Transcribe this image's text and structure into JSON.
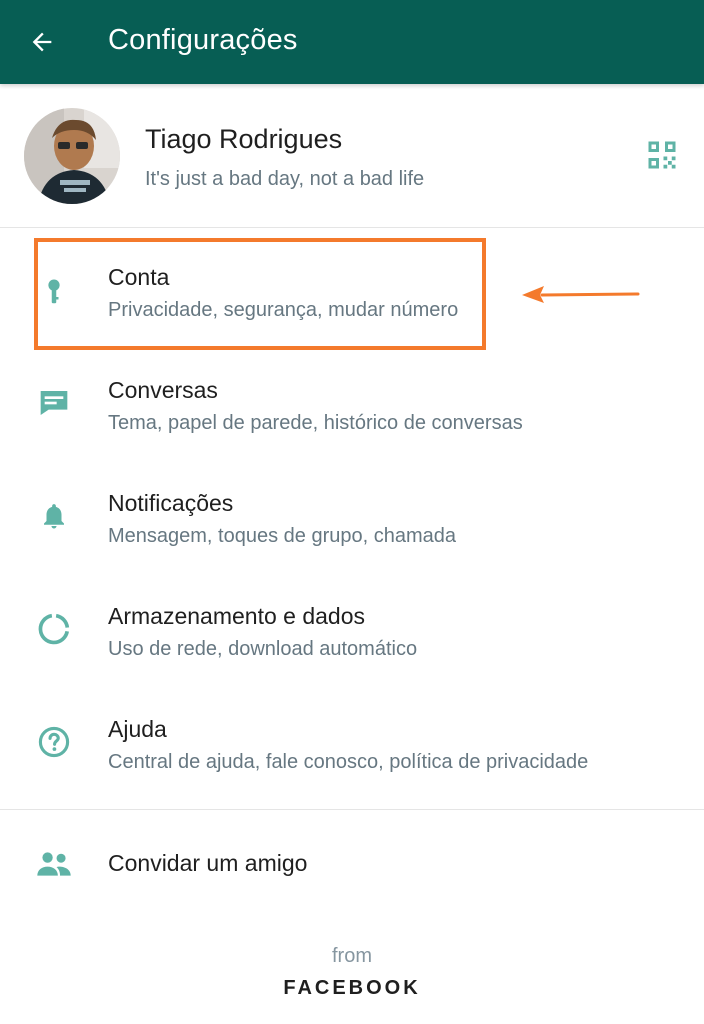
{
  "appbar": {
    "title": "Configurações",
    "background": "#075e54"
  },
  "profile": {
    "name": "Tiago Rodrigues",
    "status": "It's just a bad day, not a bad life",
    "qr_icon": "qr-code-icon"
  },
  "menu": [
    {
      "label": "Conta",
      "sub": "Privacidade, segurança, mudar número",
      "icon": "key-icon"
    },
    {
      "label": "Conversas",
      "sub": "Tema, papel de parede, histórico de conversas",
      "icon": "chat-icon"
    },
    {
      "label": "Notificações",
      "sub": "Mensagem, toques de grupo, chamada",
      "icon": "bell-icon"
    },
    {
      "label": "Armazenamento e dados",
      "sub": "Uso de rede, download automático",
      "icon": "data-usage-icon"
    },
    {
      "label": "Ajuda",
      "sub": "Central de ajuda, fale conosco, política de privacidade",
      "icon": "help-icon"
    }
  ],
  "invite": {
    "label": "Convidar um amigo",
    "icon": "people-icon"
  },
  "footer": {
    "from": "from",
    "brand": "FACEBOOK"
  },
  "colors": {
    "accent": "#075e54",
    "icon": "#5fb3a6",
    "annotation": "#f47a2c"
  }
}
